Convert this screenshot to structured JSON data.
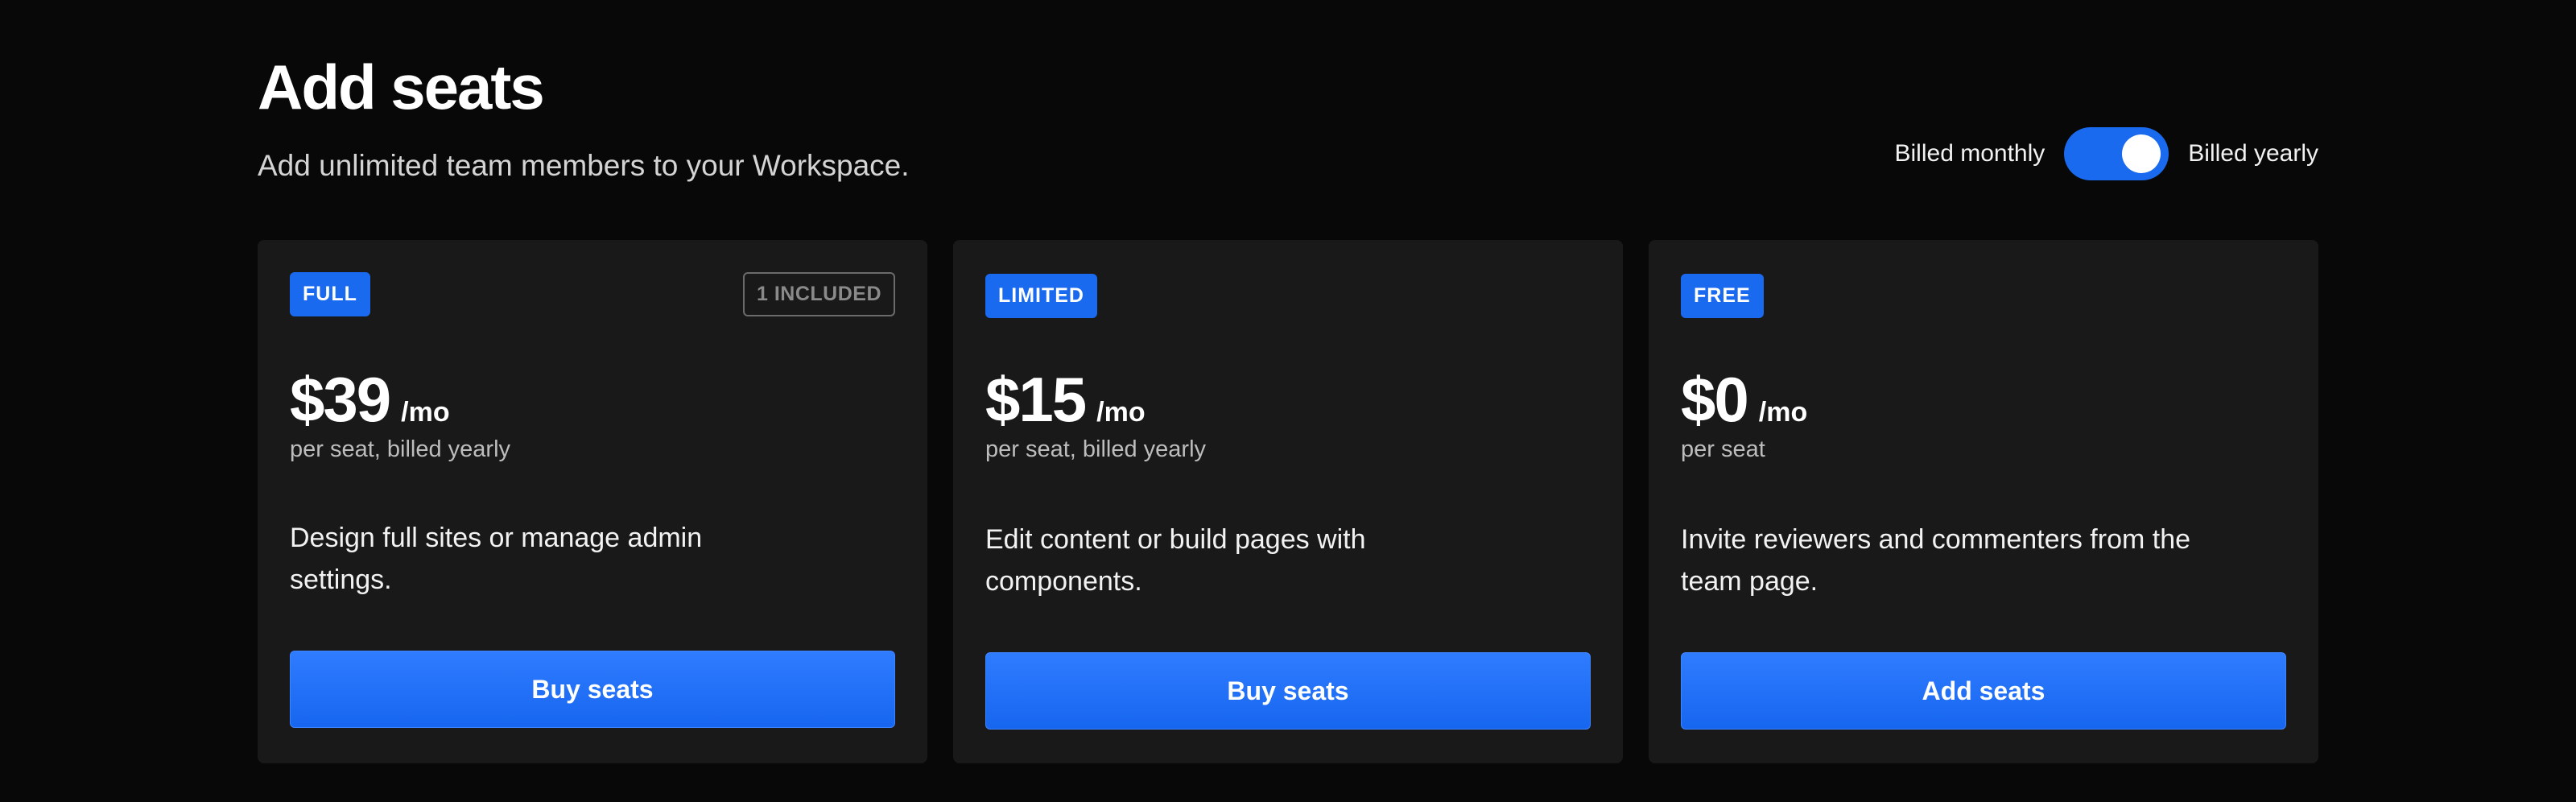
{
  "header": {
    "title": "Add seats",
    "subtitle": "Add unlimited team members to your Workspace."
  },
  "billing": {
    "monthly_label": "Billed monthly",
    "yearly_label": "Billed yearly",
    "selected": "yearly"
  },
  "colors": {
    "accent": "#1a6af0",
    "background": "#080808",
    "card": "#191919"
  },
  "plans": [
    {
      "badge": "FULL",
      "included": "1 INCLUDED",
      "price": "$39",
      "unit": "/mo",
      "billing_note": "per seat, billed yearly",
      "description": "Design full sites or manage admin settings.",
      "button": "Buy seats"
    },
    {
      "badge": "LIMITED",
      "price": "$15",
      "unit": "/mo",
      "billing_note": "per seat, billed yearly",
      "description": "Edit content or build pages with components.",
      "button": "Buy seats"
    },
    {
      "badge": "FREE",
      "price": "$0",
      "unit": "/mo",
      "billing_note": "per seat",
      "description": "Invite reviewers and commenters from the team page.",
      "button": "Add seats"
    }
  ]
}
